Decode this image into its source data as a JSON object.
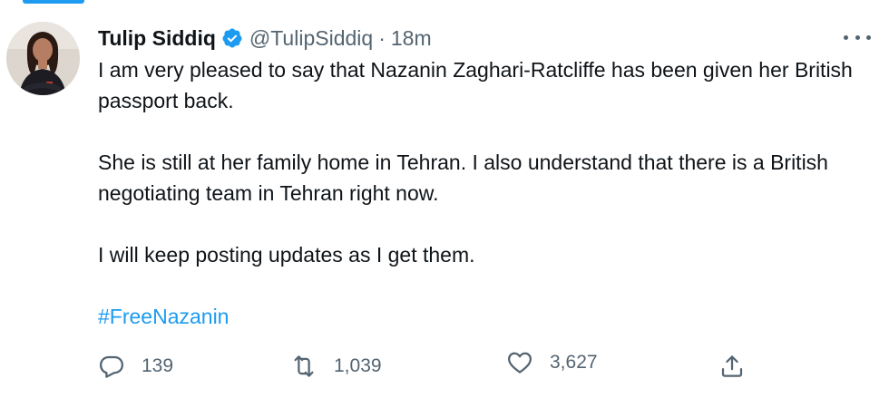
{
  "tweet": {
    "display_name": "Tulip Siddiq",
    "handle": "@TulipSiddiq",
    "separator": "·",
    "time": "18m",
    "paragraphs": [
      "I am very pleased to say that Nazanin Zaghari-Ratcliffe has been given her British passport back.",
      "She is still at her family home in Tehran. I also understand that there is a British negotiating team in Tehran right now.",
      "I will keep posting updates as I get them."
    ],
    "hashtag": "#FreeNazanin",
    "verified": true
  },
  "actions": {
    "replies": "139",
    "retweets": "1,039",
    "likes": "3,627"
  },
  "icons": {
    "verified": "verified-badge-icon",
    "more": "more-options-icon",
    "reply": "reply-icon",
    "retweet": "retweet-icon",
    "like": "like-icon",
    "share": "share-icon"
  },
  "colors": {
    "accent": "#1d9bf0",
    "text": "#0f1419",
    "secondary": "#536471"
  }
}
